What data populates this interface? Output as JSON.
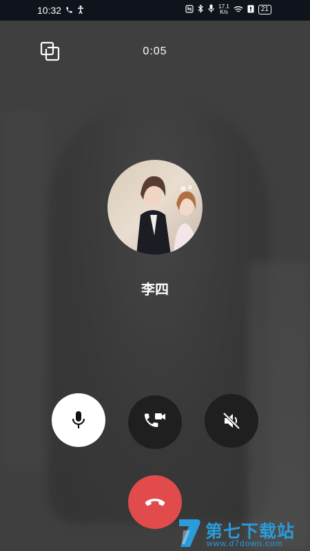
{
  "status_bar": {
    "time": "10:32",
    "net_speed_value": "17.1",
    "net_speed_unit": "K/s",
    "battery": "21"
  },
  "call": {
    "duration": "0:05",
    "caller_name": "李四"
  },
  "controls": {
    "mic": "microphone-icon",
    "switch_video": "phone-video-switch-icon",
    "speaker": "speaker-muted-icon",
    "hangup": "hang-up-icon"
  },
  "watermark": {
    "title": "第七下载站",
    "url": "www.d7down.com"
  },
  "colors": {
    "hangup": "#e24b4b",
    "control_dark": "#1f1f1f",
    "control_light": "#ffffff",
    "watermark": "#2b9bd9"
  }
}
